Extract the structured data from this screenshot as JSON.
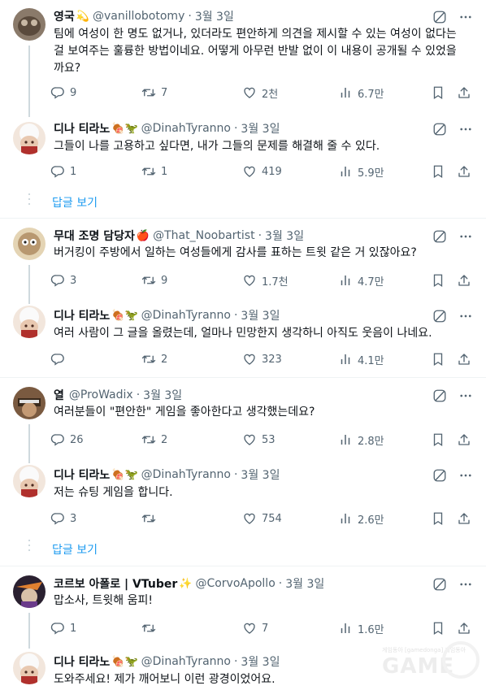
{
  "tweets": [
    {
      "name": "영국",
      "emoji": "💫",
      "handle": "@vanillobotomy",
      "time": "3월 3일",
      "text": "팀에 여성이 한 명도 없거나, 있더라도 편안하게 의견을 제시할 수 있는 여성이 없다는 걸 보여주는 훌륭한 방법이네요. 어떻게 아무런 반발 없이 이 내용이 공개될 수 있었을까요?",
      "replies": "9",
      "retweets": "7",
      "likes": "2천",
      "views": "6.7만"
    },
    {
      "name": "디나 티라노",
      "emoji": "🍖🦖",
      "handle": "@DinahTyranno",
      "time": "3월 3일",
      "text": "그들이 나를 고용하고 싶다면, 내가 그들의 문제를 해결해 줄 수 있다.",
      "replies": "1",
      "retweets": "1",
      "likes": "419",
      "views": "5.9만"
    },
    {
      "name": "무대 조명 담당자",
      "emoji": "🍎",
      "handle": "@That_Noobartist",
      "time": "3월 3일",
      "text": "버거킹이 주방에서 일하는 여성들에게 감사를 표하는 트윗 같은 거 있잖아요?",
      "replies": "3",
      "retweets": "9",
      "likes": "1.7천",
      "views": "4.7만"
    },
    {
      "name": "디나 티라노",
      "emoji": "🍖🦖",
      "handle": "@DinahTyranno",
      "time": "3월 3일",
      "text": "여러 사람이 그 글을 올렸는데, 얼마나 민망한지 생각하니 아직도 웃음이 나네요.",
      "replies": "",
      "retweets": "2",
      "likes": "323",
      "views": "4.1만"
    },
    {
      "name": "열",
      "emoji": "",
      "handle": "@ProWadix",
      "time": "3월 3일",
      "text": "여러분들이 \"편안한\" 게임을 좋아한다고 생각했는데요?",
      "replies": "26",
      "retweets": "2",
      "likes": "53",
      "views": "2.8만"
    },
    {
      "name": "디나 티라노",
      "emoji": "🍖🦖",
      "handle": "@DinahTyranno",
      "time": "3월 3일",
      "text": "저는 슈팅 게임을 합니다.",
      "replies": "3",
      "retweets": "",
      "likes": "754",
      "views": "2.6만"
    },
    {
      "name": "코르보 아폴로 | VTuber",
      "emoji": "✨",
      "handle": "@CorvoApollo",
      "time": "3월 3일",
      "text": "맙소사, 트윗해 움피!",
      "replies": "1",
      "retweets": "",
      "likes": "7",
      "views": "1.6만"
    },
    {
      "name": "디나 티라노",
      "emoji": "🍖🦖",
      "handle": "@DinahTyranno",
      "time": "3월 3일",
      "text": "도와주세요! 제가 깨어보니 이런 광경이었어요.",
      "replies": "",
      "retweets": "",
      "likes": "",
      "views": ""
    }
  ],
  "show_replies_label": "답글 보기",
  "separator": "·",
  "icons": {
    "reply": "reply-icon",
    "retweet": "retweet-icon",
    "like": "heart-icon",
    "views": "views-icon",
    "bookmark": "bookmark-icon",
    "share": "share-icon",
    "grok": "grok-icon",
    "more": "more-icon"
  },
  "watermark": {
    "logo": "GAME",
    "caption": "게임동아 [gamedonga] 게임동아"
  },
  "colors": {
    "text": "#0f1419",
    "secondary": "#536471",
    "link": "#1d9bf0",
    "line": "#cfd9de"
  }
}
